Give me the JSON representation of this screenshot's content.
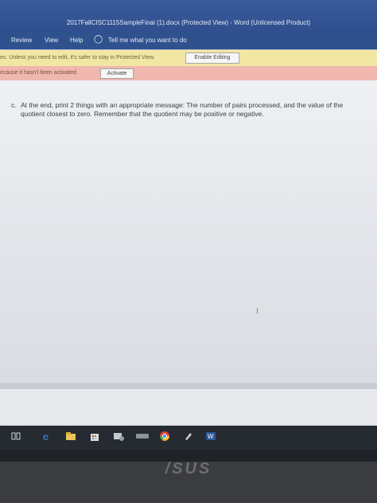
{
  "window": {
    "title": "2017FallCISC1115SampleFinal (1).docx (Protected View)  -  Word (Unlicensed Product)"
  },
  "ribbon": {
    "tabs": [
      "Review",
      "View",
      "Help"
    ],
    "tell_me": "Tell me what you want to do"
  },
  "protected_bar": {
    "message": "es. Unless you need to edit, it's safer to stay in Protected View.",
    "button": "Enable Editing"
  },
  "activation_bar": {
    "message": "ecause it hasn't been activated.",
    "button": "Activate"
  },
  "document": {
    "item_letter": "c.",
    "item_text": "At the end, print 2 things with an appropriate message: The number of pairs processed, and the value of the quotient closest to zero. Remember that the quotient may be positive or negative."
  },
  "laptop": {
    "brand": "/SUS"
  },
  "taskbar_icons": [
    "task-view-icon",
    "edge-icon",
    "file-explorer-icon",
    "store-icon",
    "app-icon",
    "keyboard-icon",
    "chrome-icon",
    "app-icon-2",
    "word-icon"
  ]
}
